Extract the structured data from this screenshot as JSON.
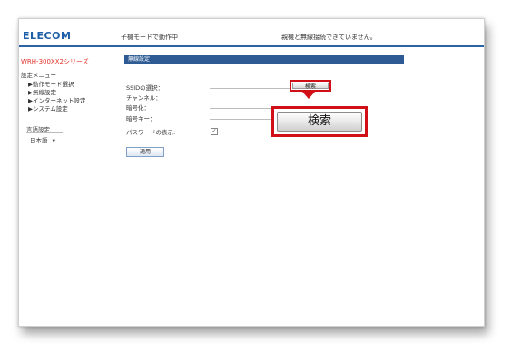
{
  "header": {
    "logo": "ELECOM",
    "mode_status": "子機モードで動作中",
    "connection_status": "親機と無線接続できていません。"
  },
  "sidebar": {
    "series": "WRH-300XX2シリーズ",
    "menu_title": "設定メニュー",
    "items": [
      {
        "label": "▶動作モード選択"
      },
      {
        "label": "▶無線設定"
      },
      {
        "label": "▶インターネット設定"
      },
      {
        "label": "▶システム設定"
      }
    ],
    "language_title": "言語設定",
    "language_value": "日本語",
    "language_caret": "▾"
  },
  "main": {
    "section_title": "無線設定",
    "fields": {
      "ssid_label": "SSIDの選択：",
      "channel_label": "チャンネル：",
      "encryption_label": "暗号化：",
      "key_label": "暗号キー：",
      "show_password_label": "パスワードの表示:"
    },
    "search_button": "検索",
    "search_callout": "検索",
    "show_password_checked": true,
    "checkbox_mark": "✓",
    "apply_button": "適用"
  },
  "colors": {
    "accent": "#2b63a7",
    "highlight": "#d10f16",
    "series_text": "#e0312a"
  }
}
